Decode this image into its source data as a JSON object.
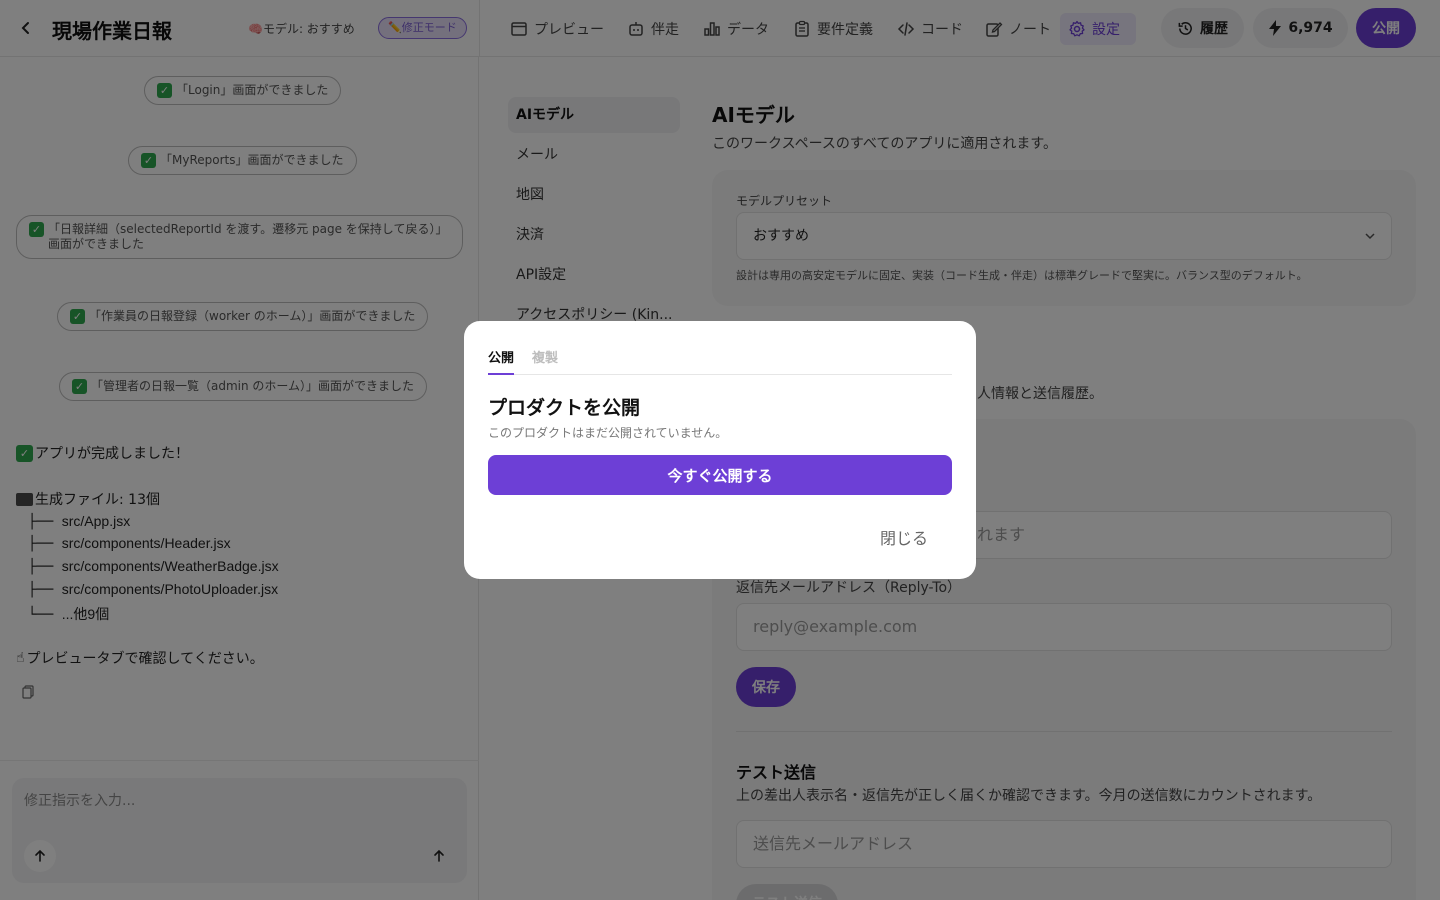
{
  "header": {
    "title": "現場作業日報",
    "model_label": "🧠モデル: おすすめ",
    "mode_badge": "✏️修正モード",
    "tabs": [
      {
        "label": "プレビュー",
        "icon": "window-icon"
      },
      {
        "label": "伴走",
        "icon": "robot-icon"
      },
      {
        "label": "データ",
        "icon": "bar-chart-icon"
      },
      {
        "label": "要件定義",
        "icon": "clipboard-icon"
      },
      {
        "label": "コード",
        "icon": "code-icon"
      },
      {
        "label": "ノート",
        "icon": "edit-icon"
      },
      {
        "label": "設定",
        "icon": "gear-icon",
        "active": true
      }
    ],
    "history_label": "履歴",
    "credits": "6,974",
    "publish_label": "公開"
  },
  "chat": {
    "status_messages": [
      "「Login」画面ができました",
      "「MyReports」画面ができました",
      "「日報詳細（selectedReportId を渡す。遷移元 page を保持して戻る）」画面ができました",
      "「作業員の日報登録（worker のホーム）」画面ができました",
      "「管理者の日報一覧（admin のホーム）」画面ができました"
    ],
    "completion": "アプリが完成しました！",
    "files_header": "生成ファイル: 13個",
    "files": [
      {
        "prefix": "├──",
        "name": "src/App.jsx"
      },
      {
        "prefix": "├──",
        "name": "src/components/Header.jsx"
      },
      {
        "prefix": "├──",
        "name": "src/components/WeatherBadge.jsx"
      },
      {
        "prefix": "├──",
        "name": "src/components/PhotoUploader.jsx"
      },
      {
        "prefix": "└──",
        "name": "...他9個"
      }
    ],
    "preview_hint": "プレビュータブで確認してください。",
    "input_placeholder": "修正指示を入力..."
  },
  "settings": {
    "sidebar": [
      "AIモデル",
      "メール",
      "地図",
      "決済",
      "API設定",
      "アクセスポリシー (Kin..."
    ],
    "ai_model": {
      "title": "AIモデル",
      "description": "このワークスペースのすべてのアプリに適用されます。",
      "preset_label": "モデルプリセット",
      "preset_value": "おすすめ",
      "preset_hint": "設計は専用の高安定モデルに固定、実装（コード生成・伴走）は標準グレードで堅実に。バランス型のデフォルト。"
    },
    "mail": {
      "description_partial": "人情報と送信履歴。",
      "sender_field_partial": "れます",
      "reply_to_label": "返信先メールアドレス（Reply-To）",
      "reply_to_placeholder": "reply@example.com",
      "save_label": "保存",
      "test_title": "テスト送信",
      "test_description": "上の差出人表示名・返信先が正しく届くか確認できます。今月の送信数にカウントされます。",
      "test_placeholder": "送信先メールアドレス",
      "test_button": "テスト送信"
    }
  },
  "modal": {
    "tabs": [
      "公開",
      "複製"
    ],
    "title": "プロダクトを公開",
    "description": "このプロダクトはまだ公開されていません。",
    "primary_label": "今すぐ公開する",
    "close_label": "閉じる"
  },
  "colors": {
    "accent": "#6d3fd6",
    "overlay": "rgba(0,0,0,0.5)",
    "check": "#2fa84f"
  }
}
